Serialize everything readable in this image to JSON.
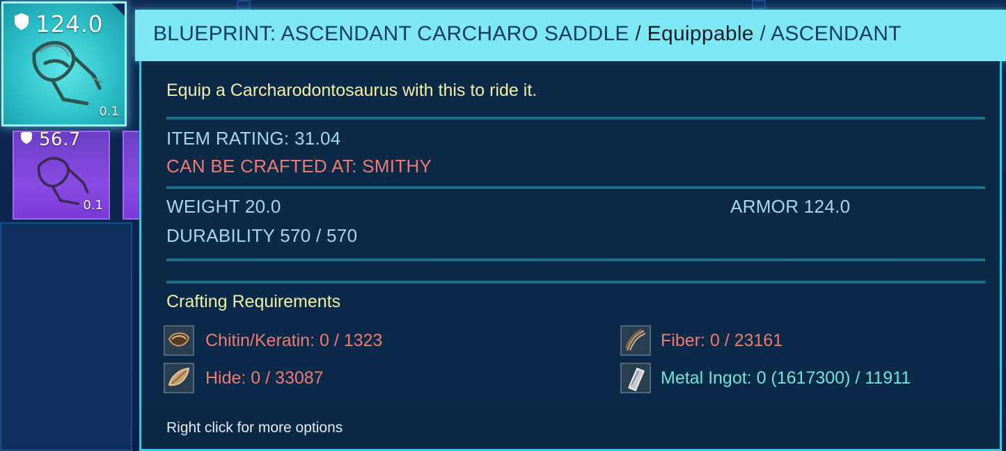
{
  "selected_item": {
    "armor_value": "124.0",
    "weight": "0.1"
  },
  "other_item": {
    "armor_value": "56.7",
    "weight": "0.1"
  },
  "tooltip": {
    "title_prefix": "BLUEPRINT: ASCENDANT CARCHARO SADDLE",
    "title_sep1": "/",
    "title_category": "Equippable",
    "title_sep2": "/",
    "title_quality": "ASCENDANT",
    "description": "Equip a Carcharodontosaurus with this to ride it.",
    "item_rating": "ITEM RATING: 31.04",
    "crafted_at": "CAN BE CRAFTED AT: SMITHY",
    "weight": "WEIGHT 20.0",
    "armor": "ARMOR 124.0",
    "durability": "DURABILITY 570 / 570",
    "crafting_title": "Crafting Requirements",
    "requirements": [
      {
        "label": "Chitin/Keratin: 0 / 1323",
        "icon": "chitin-icon",
        "color": "#f07b70"
      },
      {
        "label": "Fiber: 0 / 23161",
        "icon": "fiber-icon",
        "color": "#f07b70"
      },
      {
        "label": "Hide: 0 / 33087",
        "icon": "hide-icon",
        "color": "#f07b70"
      },
      {
        "label": "Metal Ingot: 0 (1617300) / 11911",
        "icon": "metal-ingot-icon",
        "color": "#6fe6d8"
      }
    ],
    "hint": "Right click for more options"
  },
  "colors": {
    "header_bg": "#7de8f4",
    "panel_bg": "#0c2a48",
    "selected_slot": "#2bbfc8",
    "purple_slot": "#8a4be3",
    "description": "#f3f0a4",
    "stat": "#a9d7ea",
    "warning": "#f07b70",
    "met": "#6fe6d8"
  }
}
